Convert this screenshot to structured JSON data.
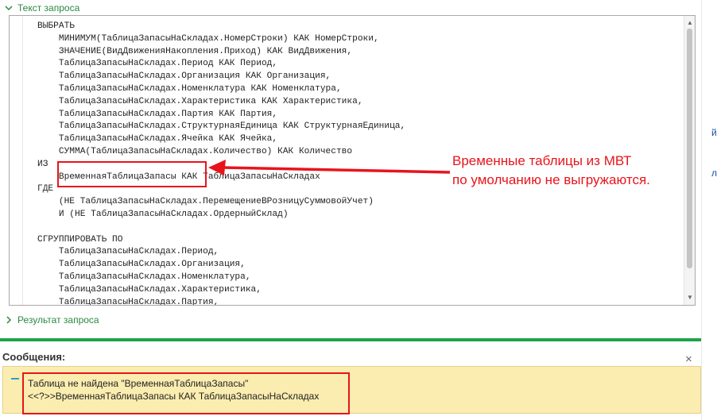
{
  "query_section": {
    "title": "Текст запроса",
    "expanded": true
  },
  "result_section": {
    "title": "Результат запроса",
    "expanded": false
  },
  "code_lines": [
    "ВЫБРАТЬ",
    "    МИНИМУМ(ТаблицаЗапасыНаСкладах.НомерСтроки) КАК НомерСтроки,",
    "    ЗНАЧЕНИЕ(ВидДвиженияНакопления.Приход) КАК ВидДвижения,",
    "    ТаблицаЗапасыНаСкладах.Период КАК Период,",
    "    ТаблицаЗапасыНаСкладах.Организация КАК Организация,",
    "    ТаблицаЗапасыНаСкладах.Номенклатура КАК Номенклатура,",
    "    ТаблицаЗапасыНаСкладах.Характеристика КАК Характеристика,",
    "    ТаблицаЗапасыНаСкладах.Партия КАК Партия,",
    "    ТаблицаЗапасыНаСкладах.СтруктурнаяЕдиница КАК СтруктурнаяЕдиница,",
    "    ТаблицаЗапасыНаСкладах.Ячейка КАК Ячейка,",
    "    СУММА(ТаблицаЗапасыНаСкладах.Количество) КАК Количество",
    "ИЗ",
    "    ВременнаяТаблицаЗапасы КАК ТаблицаЗапасыНаСкладах",
    "ГДЕ",
    "    (НЕ ТаблицаЗапасыНаСкладах.ПеремещениеВРозницуСуммовойУчет)",
    "    И (НЕ ТаблицаЗапасыНаСкладах.ОрдерныйСклад)",
    "",
    "СГРУППИРОВАТЬ ПО",
    "    ТаблицаЗапасыНаСкладах.Период,",
    "    ТаблицаЗапасыНаСкладах.Организация,",
    "    ТаблицаЗапасыНаСкладах.Номенклатура,",
    "    ТаблицаЗапасыНаСкладах.Характеристика,",
    "    ТаблицаЗапасыНаСкладах.Партия,"
  ],
  "annotation": {
    "line1": "Временные таблицы из МВТ",
    "line2": "по умолчанию не выгружаются."
  },
  "messages": {
    "title": "Сообщения:",
    "close_label": "×",
    "items": [
      {
        "line1": "Таблица не найдена \"ВременнаяТаблицаЗапасы\"",
        "line2": "<<?>>ВременнаяТаблицаЗапасы КАК ТаблицаЗапасыНаСкладах"
      }
    ]
  },
  "right_edge": {
    "t1": "й",
    "t2": "л"
  },
  "colors": {
    "accent_green": "#2a8a3f",
    "divider_green": "#1fa34a",
    "annotation_red": "#e8141c",
    "message_bg": "#fbedb0",
    "link_blue": "#1a4fa0"
  }
}
